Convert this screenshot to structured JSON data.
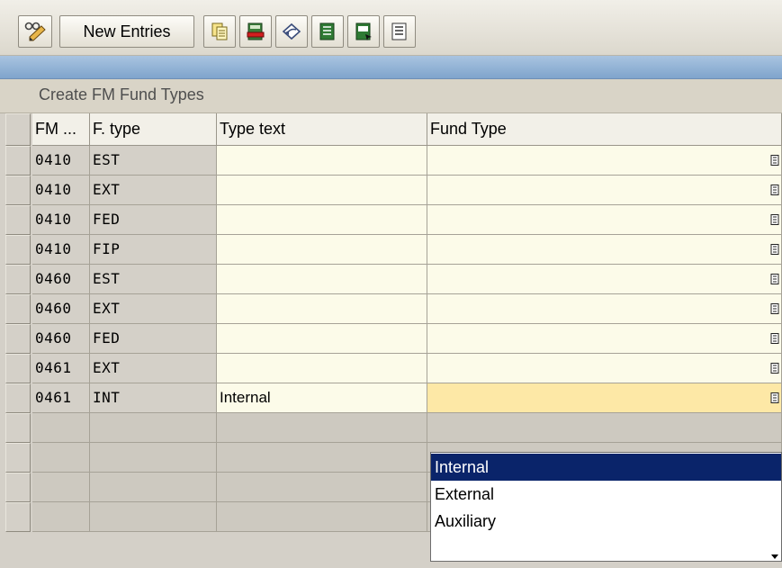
{
  "toolbar": {
    "buttons": [
      {
        "name": "display-change-toggle-button",
        "icon": "pencil-glasses-icon"
      },
      {
        "name": "new-entries-button",
        "label": "New Entries"
      },
      {
        "name": "copy-as-button",
        "icon": "copy-icon"
      },
      {
        "name": "delete-button",
        "icon": "delete-icon"
      },
      {
        "name": "undo-change-button",
        "icon": "undo-icon"
      },
      {
        "name": "select-all-button",
        "icon": "select-all-icon"
      },
      {
        "name": "select-block-button",
        "icon": "select-block-icon"
      },
      {
        "name": "deselect-all-button",
        "icon": "deselect-all-icon"
      }
    ]
  },
  "screen": {
    "title": "Create FM Fund Types"
  },
  "table": {
    "columns": [
      "FM ...",
      "F. type",
      "Type text",
      "Fund Type"
    ],
    "rows": [
      {
        "fm": "0410",
        "ftype": "EST",
        "text": "",
        "fund_type": ""
      },
      {
        "fm": "0410",
        "ftype": "EXT",
        "text": "",
        "fund_type": ""
      },
      {
        "fm": "0410",
        "ftype": "FED",
        "text": "",
        "fund_type": ""
      },
      {
        "fm": "0410",
        "ftype": "FIP",
        "text": "",
        "fund_type": ""
      },
      {
        "fm": "0460",
        "ftype": "EST",
        "text": "",
        "fund_type": ""
      },
      {
        "fm": "0460",
        "ftype": "EXT",
        "text": "",
        "fund_type": ""
      },
      {
        "fm": "0460",
        "ftype": "FED",
        "text": "",
        "fund_type": ""
      },
      {
        "fm": "0461",
        "ftype": "EXT",
        "text": "",
        "fund_type": ""
      },
      {
        "fm": "0461",
        "ftype": "INT",
        "text": "Internal",
        "fund_type": ""
      }
    ]
  },
  "dropdown": {
    "options": [
      "Internal",
      "External",
      "Auxiliary"
    ],
    "selected": "Internal"
  },
  "colors": {
    "highlight": "#0a246a",
    "active_field": "#fde8a6",
    "input_field": "#fcfbe9"
  }
}
